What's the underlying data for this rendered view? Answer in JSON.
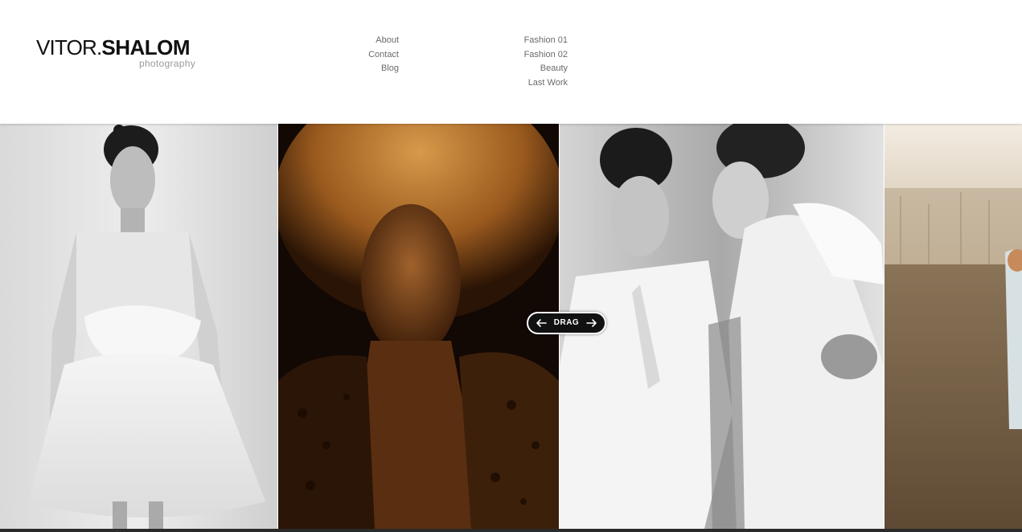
{
  "brand": {
    "first_name": "VITOR.",
    "last_name": "SHALOM",
    "subtitle": "photography"
  },
  "nav": {
    "main_items": [
      "About",
      "Contact",
      "Blog"
    ],
    "gallery_items": [
      "Fashion 01",
      "Fashion 02",
      "Beauty",
      "Last Work"
    ]
  },
  "slider": {
    "drag_label": "DRAG",
    "left_icon": "arrow-left-icon",
    "right_icon": "arrow-right-icon"
  },
  "photos": [
    {
      "name": "bw-white-dress-model",
      "tone": "black-and-white"
    },
    {
      "name": "warm-toned-portrait-leopard-print",
      "tone": "sepia-gold"
    },
    {
      "name": "two-models-white-outfits",
      "tone": "black-and-white"
    },
    {
      "name": "outdoor-field-model",
      "tone": "warm-desaturated"
    }
  ],
  "colors": {
    "header_bg": "#ffffff",
    "nav_text": "#6a6a6a",
    "logo_text": "#111111",
    "subtitle_text": "#9a9a9a",
    "drag_bg": "#111111"
  }
}
